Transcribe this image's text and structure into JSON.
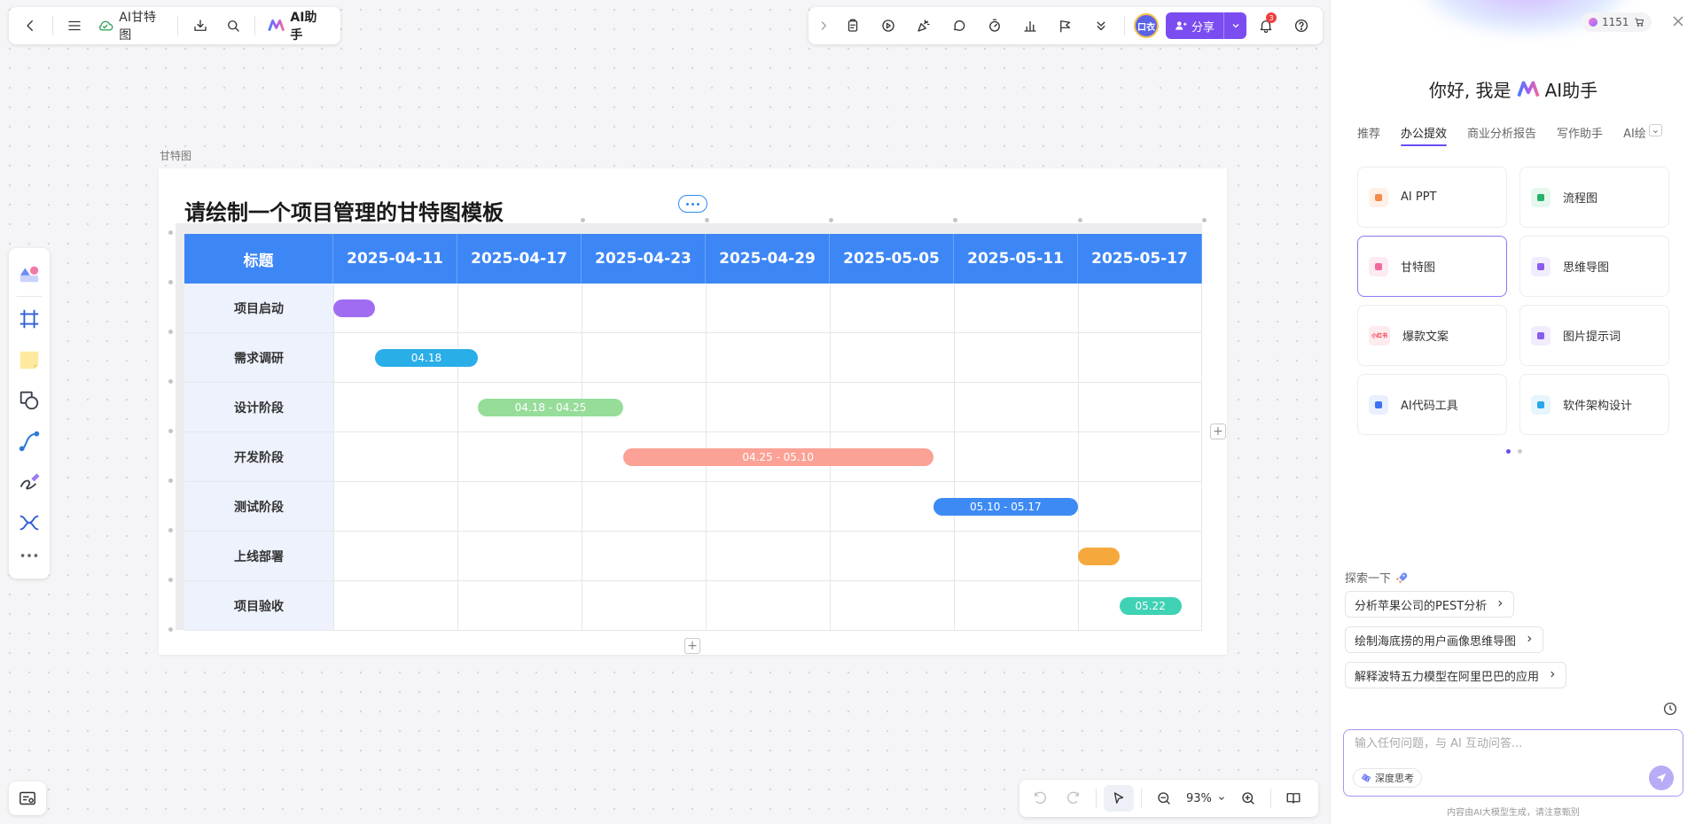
{
  "toolbar": {
    "doc_title": "AI甘特图",
    "ai_label": "AI助手",
    "avatar_text": "口衣",
    "share_label": "分享",
    "notification_count": "3"
  },
  "canvas": {
    "frame_label": "甘特图",
    "title": "请绘制一个项目管理的甘特图模板",
    "zoom": "93%"
  },
  "gantt": {
    "header": [
      "标题",
      "2025-04-11",
      "2025-04-17",
      "2025-04-23",
      "2025-04-29",
      "2025-05-05",
      "2025-05-11",
      "2025-05-17"
    ],
    "tasks": [
      {
        "name": "项目启动",
        "bar_label": "",
        "start": "2025-04-11",
        "end": "2025-04-13",
        "color": "#a06cf2"
      },
      {
        "name": "需求调研",
        "bar_label": "04.18",
        "start": "2025-04-13",
        "end": "2025-04-18",
        "color": "#29aee8"
      },
      {
        "name": "设计阶段",
        "bar_label": "04.18 - 04.25",
        "start": "2025-04-18",
        "end": "2025-04-25",
        "color": "#96dd9a"
      },
      {
        "name": "开发阶段",
        "bar_label": "04.25 - 05.10",
        "start": "2025-04-25",
        "end": "2025-05-10",
        "color": "#fba195"
      },
      {
        "name": "测试阶段",
        "bar_label": "05.10 - 05.17",
        "start": "2025-05-10",
        "end": "2025-05-17",
        "color": "#3d8af5"
      },
      {
        "name": "上线部署",
        "bar_label": "",
        "start": "2025-05-17",
        "end": "2025-05-19",
        "color": "#f5a93d"
      },
      {
        "name": "项目验收",
        "bar_label": "05.22",
        "start": "2025-05-19",
        "end": "2025-05-22",
        "color": "#3fd2b4"
      }
    ]
  },
  "ai_panel": {
    "credits": "1151",
    "greeting_prefix": "你好, 我是",
    "greeting_name": "AI助手",
    "tabs": [
      "推荐",
      "办公提效",
      "商业分析报告",
      "写作助手",
      "AI绘"
    ],
    "active_tab": "办公提效",
    "cards": [
      {
        "label": "AI PPT",
        "icon": "ppt-icon",
        "color": "#f7894a",
        "bg": "#fff1e8",
        "icon_text": ""
      },
      {
        "label": "流程图",
        "icon": "flowchart-icon",
        "color": "#26b36a",
        "bg": "#e6f7ee",
        "icon_text": ""
      },
      {
        "label": "甘特图",
        "icon": "gantt-icon",
        "color": "#f06aa0",
        "bg": "#fdeaf2",
        "icon_text": ""
      },
      {
        "label": "思维导图",
        "icon": "mindmap-icon",
        "color": "#8a5cf0",
        "bg": "#f1ecfe",
        "icon_text": ""
      },
      {
        "label": "爆款文案",
        "icon": "xiaohongshu-icon",
        "color": "#f0384f",
        "bg": "#fdebee",
        "icon_text": "小红书"
      },
      {
        "label": "图片提示词",
        "icon": "sparkle-icon",
        "color": "#8a5cf0",
        "bg": "#f1ecfe",
        "icon_text": ""
      },
      {
        "label": "AI代码工具",
        "icon": "code-icon",
        "color": "#3d72f5",
        "bg": "#e9effe",
        "icon_text": ""
      },
      {
        "label": "软件架构设计",
        "icon": "architecture-icon",
        "color": "#2aa7e8",
        "bg": "#e7f5fd",
        "icon_text": ""
      }
    ],
    "explore_label": "探索一下",
    "suggestions": [
      "分析苹果公司的PEST分析",
      "绘制海底捞的用户画像思维导图",
      "解释波特五力模型在阿里巴巴的应用"
    ],
    "input_placeholder": "输入任何问题，与 AI 互动问答...",
    "deep_think_label": "深度思考",
    "footer_note": "内容由AI大模型生成，请注意甄别"
  }
}
